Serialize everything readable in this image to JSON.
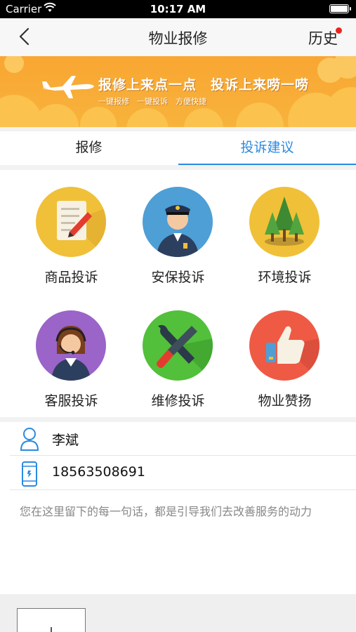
{
  "status_bar": {
    "carrier": "Carrier",
    "time": "10:17 AM"
  },
  "nav": {
    "title": "物业报修",
    "history_label": "历史"
  },
  "banner": {
    "headline": "报修上来点一点　投诉上来唠一唠",
    "subline": "一键报修　一键投诉　方便快捷"
  },
  "tabs": [
    {
      "label": "报修",
      "active": false
    },
    {
      "label": "投诉建议",
      "active": true
    }
  ],
  "categories": [
    {
      "label": "商品投诉",
      "icon": "document-pen-icon",
      "color": "#f0c038"
    },
    {
      "label": "安保投诉",
      "icon": "security-guard-icon",
      "color": "#4d9fd6"
    },
    {
      "label": "环境投诉",
      "icon": "trees-icon",
      "color": "#f0c038"
    },
    {
      "label": "客服投诉",
      "icon": "customer-service-icon",
      "color": "#9b64c9"
    },
    {
      "label": "维修投诉",
      "icon": "tools-icon",
      "color": "#52c03a"
    },
    {
      "label": "物业赞扬",
      "icon": "thumbs-up-icon",
      "color": "#ef5a45"
    }
  ],
  "contact": {
    "name": "李斌",
    "phone": "18563508691"
  },
  "message": {
    "placeholder": "您在这里留下的每一句话，都是引导我们去改善服务的动力"
  },
  "colors": {
    "accent": "#2b8ae0",
    "banner": "#f9a632",
    "badge": "#e8261d"
  }
}
